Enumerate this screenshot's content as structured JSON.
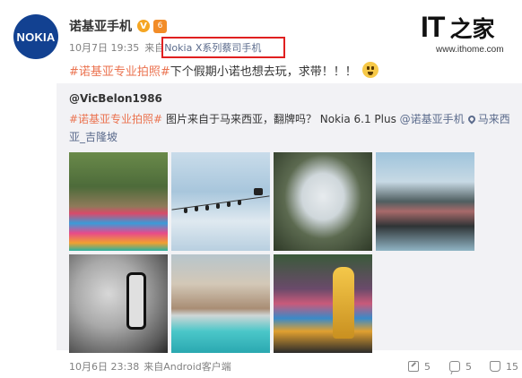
{
  "post": {
    "avatar_text": "NOKIA",
    "user_name": "诺基亚手机",
    "verified_mark": "V",
    "badge_mark": "6",
    "time": "10月7日 19:35",
    "source_prefix": "来自",
    "source_name": "Nokia X系列蔡司手机",
    "hashtag": "#诺基亚专业拍照#",
    "text": " 下个假期小诺也想去玩，求带！！！"
  },
  "watermark": {
    "logo_text": "IT",
    "logo_zh": "之家",
    "url": "www.ithome.com"
  },
  "repost": {
    "user": "@VicBelon1986",
    "hashtag": "#诺基亚专业拍照#",
    "text_main": " 图片来自于马来西亚，翻牌吗？ Nokia 6.1 Plus ",
    "mention": "@诺基亚手机",
    "location": "马来西亚_吉隆坡",
    "photos": [
      {
        "name": "photo-batu-caves-stairs"
      },
      {
        "name": "photo-birds-on-wire"
      },
      {
        "name": "photo-sky-through-trees"
      },
      {
        "name": "photo-street-reflection"
      },
      {
        "name": "photo-carved-lantern"
      },
      {
        "name": "photo-pool-building"
      },
      {
        "name": "photo-golden-statue"
      }
    ],
    "footer_time": "10月6日 23:38",
    "footer_prefix": "来自",
    "footer_source": "Android客户端",
    "actions": [
      {
        "icon": "share-icon",
        "count": "5"
      },
      {
        "icon": "comment-icon",
        "count": "5"
      },
      {
        "icon": "like-icon",
        "count": "15"
      }
    ]
  },
  "colors": {
    "hashtag": "#eb7350",
    "link": "#5b6b8c",
    "highlight_box": "#e02020",
    "repost_bg": "#f2f2f5"
  }
}
